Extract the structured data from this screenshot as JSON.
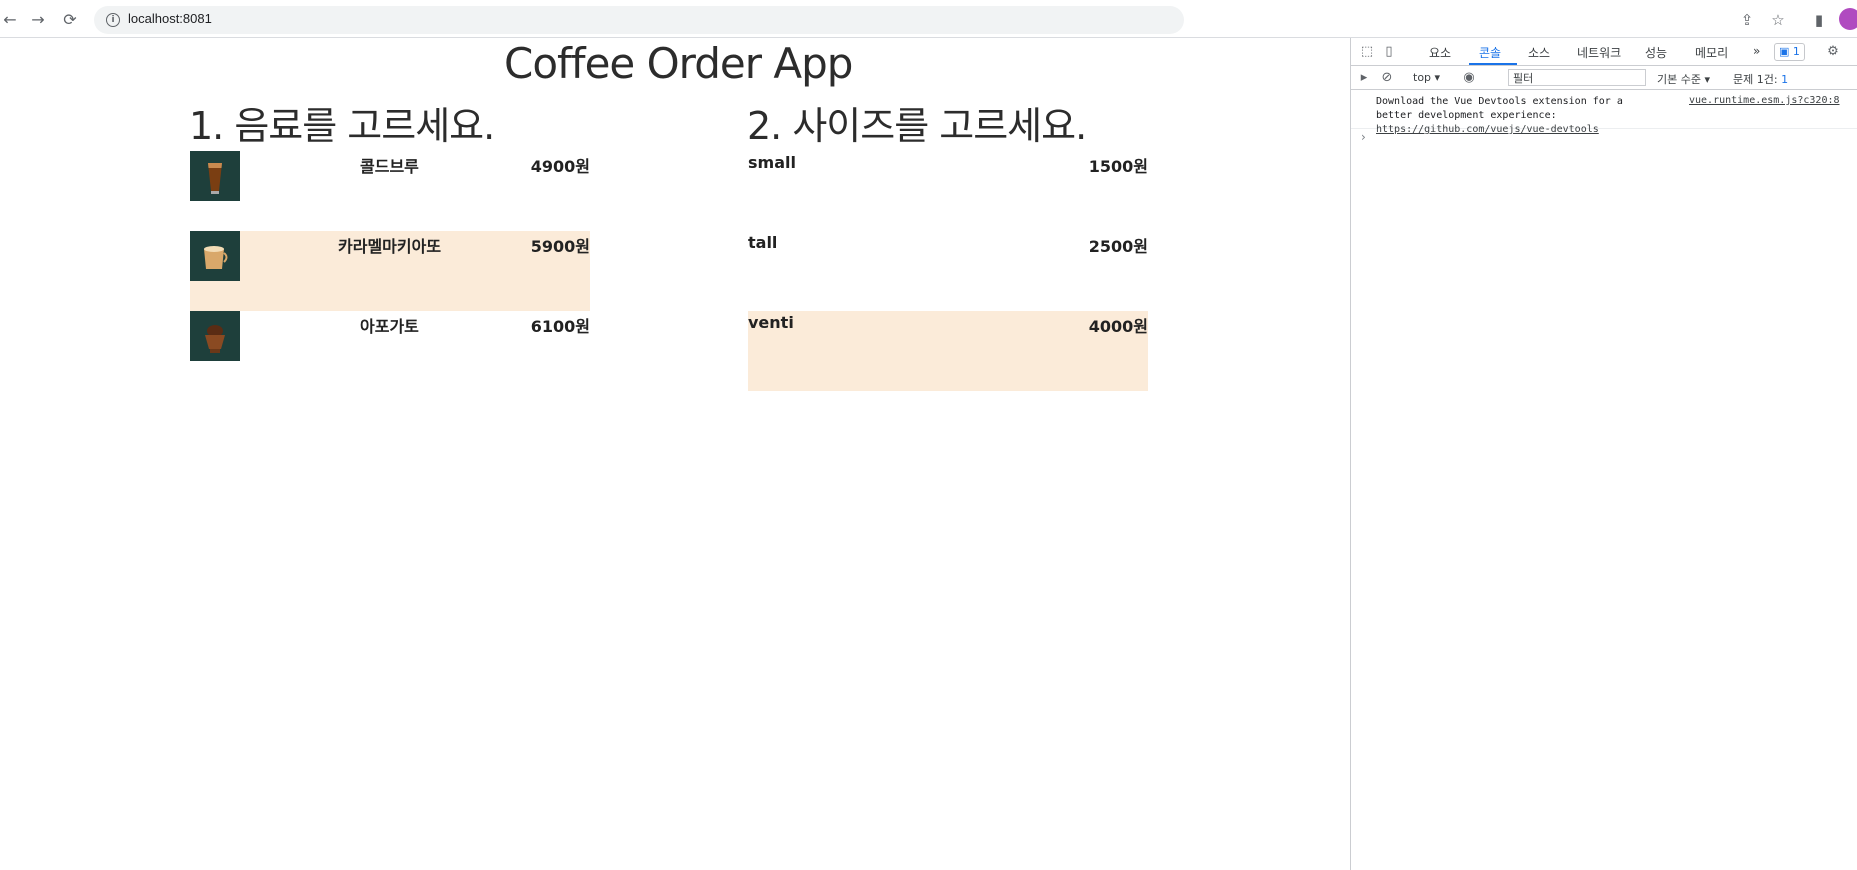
{
  "browser": {
    "url": "localhost:8081",
    "back_icon": "←",
    "forward_icon": "→",
    "reload_icon": "⟳",
    "info_icon": "i"
  },
  "page": {
    "title": "Coffee Order App",
    "drinks_heading": "1. 음료를 고르세요.",
    "size_heading": "2. 사이즈를 고르세요.",
    "drinks": [
      {
        "name": "콜드브루",
        "price": "4900원",
        "selected": false
      },
      {
        "name": "카라멜마키아또",
        "price": "5900원",
        "selected": true
      },
      {
        "name": "아포가토",
        "price": "6100원",
        "selected": false
      }
    ],
    "sizes": [
      {
        "name": "small",
        "price": "1500원",
        "selected": false
      },
      {
        "name": "tall",
        "price": "2500원",
        "selected": false
      },
      {
        "name": "venti",
        "price": "4000원",
        "selected": true
      }
    ],
    "selected_color": "#fbebd9"
  },
  "devtools": {
    "tabs": [
      "요소",
      "콘솔",
      "소스",
      "네트워크",
      "성능",
      "메모리"
    ],
    "active_tab": "콘솔",
    "more": "»",
    "issues_badge": "1",
    "context": "top ▾",
    "filter_placeholder": "필터",
    "level": "기본 수준 ▾",
    "issues_text": "문제 1건:",
    "issues_count": "1",
    "message_line1": "Download the Vue Devtools extension for a",
    "message_line2": "better development experience:",
    "message_link": "https://github.com/vuejs/vue-devtools",
    "message_source": "vue.runtime.esm.js?c320:8",
    "prompt": "›"
  }
}
